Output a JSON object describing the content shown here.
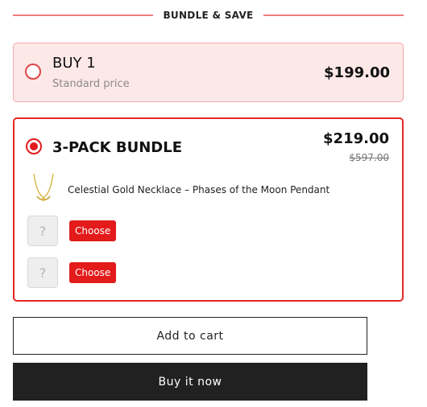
{
  "header": {
    "label": "BUNDLE & SAVE"
  },
  "colors": {
    "accent": "#e31b1b",
    "selected_bg": "#fde8e8",
    "dark_button": "#212121"
  },
  "options": [
    {
      "title": "BUY 1",
      "subtitle": "Standard price",
      "price": "$199.00",
      "selected": false
    },
    {
      "title": "3-PACK BUNDLE",
      "price": "$219.00",
      "compare_at": "$597.00",
      "selected": true,
      "items": [
        {
          "name": "Celestial Gold Necklace – Phases of the Moon Pendant",
          "icon": "necklace-image"
        },
        {
          "placeholder": "?",
          "action": "Choose"
        },
        {
          "placeholder": "?",
          "action": "Choose"
        }
      ]
    }
  ],
  "actions": {
    "add_to_cart": "Add to cart",
    "buy_now": "Buy it now"
  }
}
